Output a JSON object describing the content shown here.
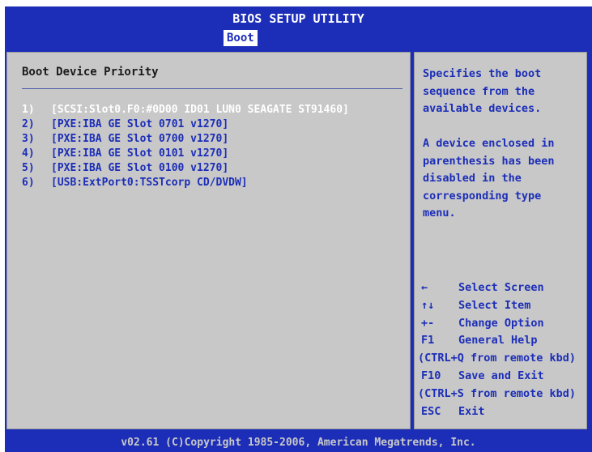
{
  "header": {
    "title": "BIOS SETUP UTILITY",
    "active_tab": "Boot"
  },
  "main": {
    "section_title": "Boot Device Priority",
    "devices": [
      {
        "num": "1)",
        "label": "[SCSI:Slot0.F0:#0D00 ID01 LUN0 SEAGATE ST91460]"
      },
      {
        "num": "2)",
        "label": "[PXE:IBA GE Slot 0701 v1270]"
      },
      {
        "num": "3)",
        "label": "[PXE:IBA GE Slot 0700 v1270]"
      },
      {
        "num": "4)",
        "label": "[PXE:IBA GE Slot 0101 v1270]"
      },
      {
        "num": "5)",
        "label": "[PXE:IBA GE Slot 0100 v1270]"
      },
      {
        "num": "6)",
        "label": "[USB:ExtPort0:TSSTcorp CD/DVDW]"
      }
    ]
  },
  "help": {
    "lines": [
      "Specifies the boot",
      "sequence from the",
      "available devices.",
      "",
      "A device enclosed in",
      "parenthesis has been",
      "disabled in the",
      "corresponding type",
      "menu."
    ]
  },
  "keys": [
    {
      "key": "←",
      "action": "Select Screen"
    },
    {
      "key": "↑↓",
      "action": "Select Item"
    },
    {
      "key": "+-",
      "action": "Change Option"
    },
    {
      "key": "F1",
      "action": "General Help"
    },
    {
      "key": "",
      "action": "(CTRL+Q from remote kbd)"
    },
    {
      "key": "F10",
      "action": "Save and Exit"
    },
    {
      "key": "",
      "action": "(CTRL+S from remote kbd)"
    },
    {
      "key": "ESC",
      "action": "Exit"
    }
  ],
  "footer": {
    "text": "v02.61 (C)Copyright 1985-2006, American Megatrends, Inc."
  }
}
